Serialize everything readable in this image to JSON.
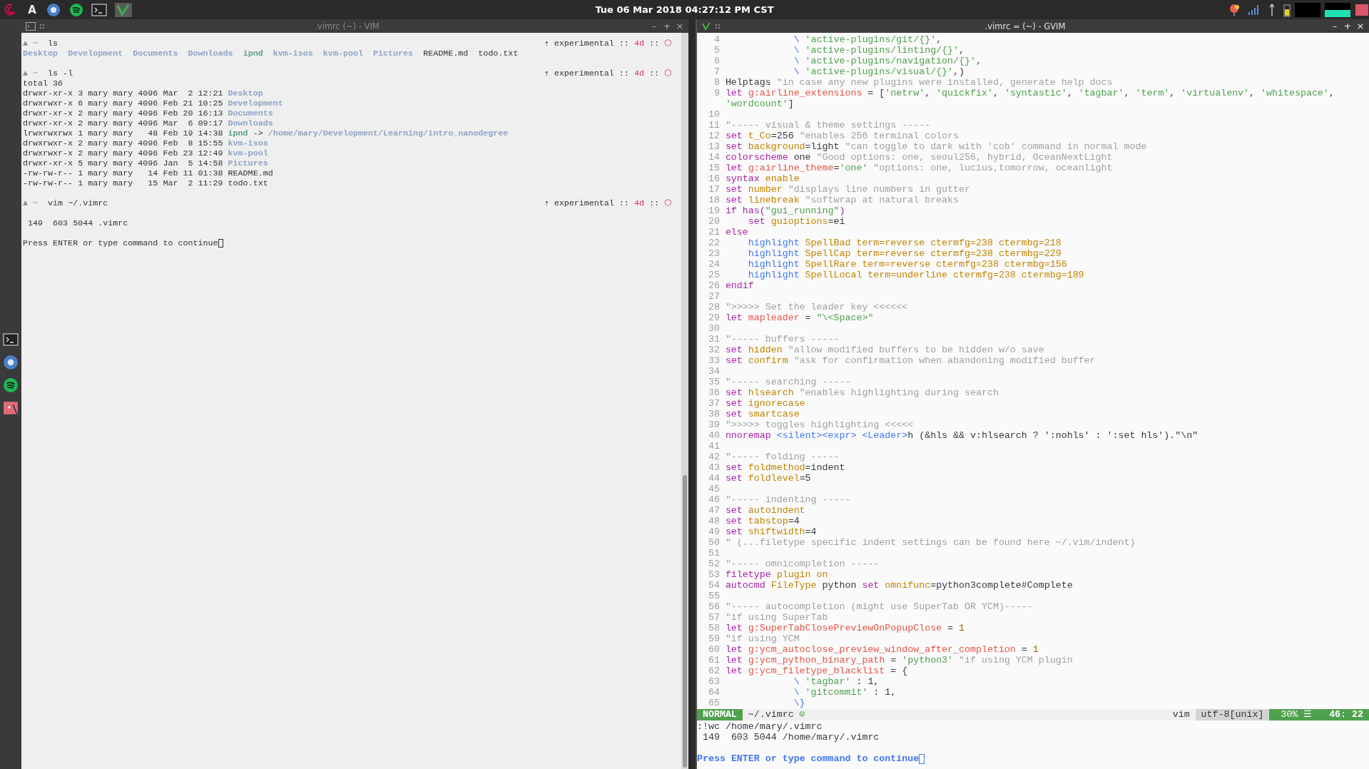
{
  "panel": {
    "launcher_letter": "A",
    "clock": "Tue 06 Mar 2018 04:27:12 PM CST"
  },
  "terminal_window": {
    "title": ".vimrc (~) - VIM",
    "active": false,
    "controls": [
      "–",
      "+",
      "×"
    ],
    "lines": [
      {
        "kind": "prompt",
        "segments": [
          {
            "kind": "prompt",
            "text": "▲ ~  "
          },
          {
            "kind": "plain",
            "text": "ls"
          }
        ],
        "status": [
          {
            "kind": "plain",
            "text": "⇡ experimental :: "
          },
          {
            "kind": "age",
            "text": "4d"
          },
          {
            "kind": "plain",
            "text": " :: "
          },
          {
            "kind": "mark",
            "text": "⬡"
          }
        ]
      },
      {
        "kind": "output",
        "segments": [
          {
            "kind": "dir",
            "text": "Desktop  "
          },
          {
            "kind": "dir",
            "text": "Development  "
          },
          {
            "kind": "dir",
            "text": "Documents  "
          },
          {
            "kind": "dir",
            "text": "Downloads  "
          },
          {
            "kind": "link",
            "text": "ipnd  "
          },
          {
            "kind": "dir",
            "text": "kvm-isos  "
          },
          {
            "kind": "dir",
            "text": "kvm-pool  "
          },
          {
            "kind": "dir",
            "text": "Pictures  "
          },
          {
            "kind": "plain",
            "text": "README.md  todo.txt"
          }
        ]
      },
      {
        "kind": "blank"
      },
      {
        "kind": "prompt",
        "segments": [
          {
            "kind": "prompt",
            "text": "▲ ~  "
          },
          {
            "kind": "plain",
            "text": "ls -l"
          }
        ],
        "status": [
          {
            "kind": "plain",
            "text": "⇡ experimental :: "
          },
          {
            "kind": "age",
            "text": "4d"
          },
          {
            "kind": "plain",
            "text": " :: "
          },
          {
            "kind": "mark",
            "text": "⬡"
          }
        ]
      },
      {
        "kind": "output",
        "segments": [
          {
            "kind": "plain",
            "text": "total 36"
          }
        ]
      },
      {
        "kind": "output",
        "segments": [
          {
            "kind": "plain",
            "text": "drwxr-xr-x 3 mary mary 4096 Mar  2 12:21 "
          },
          {
            "kind": "dir",
            "text": "Desktop"
          }
        ]
      },
      {
        "kind": "output",
        "segments": [
          {
            "kind": "plain",
            "text": "drwxrwxr-x 6 mary mary 4096 Feb 21 10:25 "
          },
          {
            "kind": "dir",
            "text": "Development"
          }
        ]
      },
      {
        "kind": "output",
        "segments": [
          {
            "kind": "plain",
            "text": "drwxr-xr-x 2 mary mary 4096 Feb 20 16:13 "
          },
          {
            "kind": "dir",
            "text": "Documents"
          }
        ]
      },
      {
        "kind": "output",
        "segments": [
          {
            "kind": "plain",
            "text": "drwxr-xr-x 2 mary mary 4096 Mar  6 09:17 "
          },
          {
            "kind": "dir",
            "text": "Downloads"
          }
        ]
      },
      {
        "kind": "output",
        "segments": [
          {
            "kind": "plain",
            "text": "lrwxrwxrwx 1 mary mary   48 Feb 19 14:38 "
          },
          {
            "kind": "link",
            "text": "ipnd"
          },
          {
            "kind": "plain",
            "text": " -> "
          },
          {
            "kind": "dir",
            "text": "/home/mary/Development/Learning/intro_nanodegree"
          }
        ]
      },
      {
        "kind": "output",
        "segments": [
          {
            "kind": "plain",
            "text": "drwxrwxr-x 2 mary mary 4096 Feb  8 15:55 "
          },
          {
            "kind": "dir",
            "text": "kvm-isos"
          }
        ]
      },
      {
        "kind": "output",
        "segments": [
          {
            "kind": "plain",
            "text": "drwxrwxr-x 2 mary mary 4096 Feb 23 12:49 "
          },
          {
            "kind": "dir",
            "text": "kvm-pool"
          }
        ]
      },
      {
        "kind": "output",
        "segments": [
          {
            "kind": "plain",
            "text": "drwxr-xr-x 5 mary mary 4096 Jan  5 14:58 "
          },
          {
            "kind": "dir",
            "text": "Pictures"
          }
        ]
      },
      {
        "kind": "output",
        "segments": [
          {
            "kind": "plain",
            "text": "-rw-rw-r-- 1 mary mary   14 Feb 11 01:38 README.md"
          }
        ]
      },
      {
        "kind": "output",
        "segments": [
          {
            "kind": "plain",
            "text": "-rw-rw-r-- 1 mary mary   15 Mar  2 11:29 todo.txt"
          }
        ]
      },
      {
        "kind": "blank"
      },
      {
        "kind": "prompt",
        "segments": [
          {
            "kind": "prompt",
            "text": "▲ ~  "
          },
          {
            "kind": "plain",
            "text": "vim ~/.vimrc"
          }
        ],
        "status": [
          {
            "kind": "plain",
            "text": "⇡ experimental :: "
          },
          {
            "kind": "age",
            "text": "4d"
          },
          {
            "kind": "plain",
            "text": " :: "
          },
          {
            "kind": "mark",
            "text": "⬡"
          }
        ]
      },
      {
        "kind": "blank"
      },
      {
        "kind": "output",
        "segments": [
          {
            "kind": "plain",
            "text": " 149  603 5044 .vimrc"
          }
        ]
      },
      {
        "kind": "blank"
      },
      {
        "kind": "cursor",
        "segments": [
          {
            "kind": "plain",
            "text": "Press ENTER or type command to continue"
          }
        ]
      }
    ]
  },
  "gvim_window": {
    "title": ".vimrc = (~) - GVIM",
    "active": true,
    "controls": [
      "–",
      "+",
      "×"
    ],
    "lines": [
      {
        "n": "4",
        "t": [
          {
            "kind": "spec",
            "text": "            \\ "
          },
          {
            "kind": "str",
            "text": "'active-plugins/git/{}'"
          },
          {
            "kind": "plain",
            "text": ","
          }
        ]
      },
      {
        "n": "5",
        "t": [
          {
            "kind": "spec",
            "text": "            \\ "
          },
          {
            "kind": "str",
            "text": "'active-plugins/linting/{}'"
          },
          {
            "kind": "plain",
            "text": ","
          }
        ]
      },
      {
        "n": "6",
        "t": [
          {
            "kind": "spec",
            "text": "            \\ "
          },
          {
            "kind": "str",
            "text": "'active-plugins/navigation/{}'"
          },
          {
            "kind": "plain",
            "text": ","
          }
        ]
      },
      {
        "n": "7",
        "t": [
          {
            "kind": "spec",
            "text": "            \\ "
          },
          {
            "kind": "str",
            "text": "'active-plugins/visual/{}'"
          },
          {
            "kind": "plain",
            "text": ",)"
          }
        ]
      },
      {
        "n": "8",
        "t": [
          {
            "kind": "plain",
            "text": "Helptags "
          },
          {
            "kind": "cmt",
            "text": "\"in case any new plugins were installed, generate help docs"
          }
        ]
      },
      {
        "n": "9",
        "t": [
          {
            "kind": "kw",
            "text": "let "
          },
          {
            "kind": "var",
            "text": "g:airline_extensions"
          },
          {
            "kind": "plain",
            "text": " = ["
          },
          {
            "kind": "str",
            "text": "'netrw'"
          },
          {
            "kind": "plain",
            "text": ", "
          },
          {
            "kind": "str",
            "text": "'quickfix'"
          },
          {
            "kind": "plain",
            "text": ", "
          },
          {
            "kind": "str",
            "text": "'syntastic'"
          },
          {
            "kind": "plain",
            "text": ", "
          },
          {
            "kind": "str",
            "text": "'tagbar'"
          },
          {
            "kind": "plain",
            "text": ", "
          },
          {
            "kind": "str",
            "text": "'term'"
          },
          {
            "kind": "plain",
            "text": ", "
          },
          {
            "kind": "str",
            "text": "'virtualenv'"
          },
          {
            "kind": "plain",
            "text": ", "
          },
          {
            "kind": "str",
            "text": "'whitespace'"
          },
          {
            "kind": "plain",
            "text": ","
          }
        ]
      },
      {
        "t": [
          {
            "kind": "str",
            "text": "'wordcount'"
          },
          {
            "kind": "plain",
            "text": "]"
          }
        ]
      },
      {
        "n": "10"
      },
      {
        "n": "11",
        "t": [
          {
            "kind": "cmt",
            "text": "\"----- visual & theme settings -----"
          }
        ]
      },
      {
        "n": "12",
        "t": [
          {
            "kind": "kw",
            "text": "set "
          },
          {
            "kind": "opt",
            "text": "t_Co"
          },
          {
            "kind": "plain",
            "text": "=256 "
          },
          {
            "kind": "cmt",
            "text": "\"enables 256 terminal colors"
          }
        ]
      },
      {
        "n": "13",
        "t": [
          {
            "kind": "kw",
            "text": "set "
          },
          {
            "kind": "opt",
            "text": "background"
          },
          {
            "kind": "plain",
            "text": "=light "
          },
          {
            "kind": "cmt",
            "text": "\"can toggle to dark with 'cob' command in normal mode"
          }
        ]
      },
      {
        "n": "14",
        "t": [
          {
            "kind": "kw",
            "text": "colorscheme "
          },
          {
            "kind": "plain",
            "text": "one "
          },
          {
            "kind": "cmt",
            "text": "\"Good options: one, seoul256, hybrid, OceanNextLight"
          }
        ]
      },
      {
        "n": "15",
        "t": [
          {
            "kind": "kw",
            "text": "let "
          },
          {
            "kind": "var",
            "text": "g:airline_theme"
          },
          {
            "kind": "plain",
            "text": "="
          },
          {
            "kind": "str",
            "text": "'one'"
          },
          {
            "kind": "cmt",
            "text": " \"options: one, lucius,tomorrow, oceanlight"
          }
        ]
      },
      {
        "n": "16",
        "t": [
          {
            "kind": "kw",
            "text": "syntax "
          },
          {
            "kind": "opt",
            "text": "enable"
          }
        ]
      },
      {
        "n": "17",
        "t": [
          {
            "kind": "kw",
            "text": "set "
          },
          {
            "kind": "opt",
            "text": "number "
          },
          {
            "kind": "cmt",
            "text": "\"displays line numbers in gutter"
          }
        ]
      },
      {
        "n": "18",
        "t": [
          {
            "kind": "kw",
            "text": "set "
          },
          {
            "kind": "opt",
            "text": "linebreak "
          },
          {
            "kind": "cmt",
            "text": "\"softwrap at natural breaks"
          }
        ]
      },
      {
        "n": "19",
        "t": [
          {
            "kind": "kw",
            "text": "if has("
          },
          {
            "kind": "str",
            "text": "\"gui_running\""
          },
          {
            "kind": "kw",
            "text": ")"
          }
        ]
      },
      {
        "n": "20",
        "t": [
          {
            "kind": "kw",
            "text": "    set "
          },
          {
            "kind": "opt",
            "text": "guioptions"
          },
          {
            "kind": "plain",
            "text": "=ei"
          }
        ]
      },
      {
        "n": "21",
        "t": [
          {
            "kind": "kw",
            "text": "else"
          }
        ]
      },
      {
        "n": "22",
        "t": [
          {
            "kind": "spec",
            "text": "    highlight "
          },
          {
            "kind": "opt",
            "text": "SpellBad term=reverse ctermfg=238 ctermbg=218"
          }
        ]
      },
      {
        "n": "23",
        "t": [
          {
            "kind": "spec",
            "text": "    highlight "
          },
          {
            "kind": "opt",
            "text": "SpellCap term=reverse ctermfg=238 ctermbg=229"
          }
        ]
      },
      {
        "n": "24",
        "t": [
          {
            "kind": "spec",
            "text": "    highlight "
          },
          {
            "kind": "opt",
            "text": "SpellRare term=reverse ctermfg=238 ctermbg=156"
          }
        ]
      },
      {
        "n": "25",
        "t": [
          {
            "kind": "spec",
            "text": "    highlight "
          },
          {
            "kind": "opt",
            "text": "SpellLocal term=underline ctermfg=238 ctermbg=189"
          }
        ]
      },
      {
        "n": "26",
        "t": [
          {
            "kind": "kw",
            "text": "endif"
          }
        ]
      },
      {
        "n": "27"
      },
      {
        "n": "28",
        "t": [
          {
            "kind": "cmt",
            "text": "\">>>>> Set the leader key <<<<<<"
          }
        ]
      },
      {
        "n": "29",
        "t": [
          {
            "kind": "kw",
            "text": "let "
          },
          {
            "kind": "var",
            "text": "mapleader"
          },
          {
            "kind": "plain",
            "text": " = "
          },
          {
            "kind": "str",
            "text": "\"\\<Space>\""
          }
        ]
      },
      {
        "n": "30"
      },
      {
        "n": "31",
        "t": [
          {
            "kind": "cmt",
            "text": "\"----- buffers -----"
          }
        ]
      },
      {
        "n": "32",
        "t": [
          {
            "kind": "kw",
            "text": "set "
          },
          {
            "kind": "opt",
            "text": "hidden "
          },
          {
            "kind": "cmt",
            "text": "\"allow modified buffers to be hidden w/o save"
          }
        ]
      },
      {
        "n": "33",
        "t": [
          {
            "kind": "kw",
            "text": "set "
          },
          {
            "kind": "opt",
            "text": "confirm "
          },
          {
            "kind": "cmt",
            "text": "\"ask for confirmation when abandoning modified buffer"
          }
        ]
      },
      {
        "n": "34"
      },
      {
        "n": "35",
        "t": [
          {
            "kind": "cmt",
            "text": "\"----- searching -----"
          }
        ]
      },
      {
        "n": "36",
        "t": [
          {
            "kind": "kw",
            "text": "set "
          },
          {
            "kind": "opt",
            "text": "hlsearch "
          },
          {
            "kind": "cmt",
            "text": "\"enables highlighting during search"
          }
        ]
      },
      {
        "n": "37",
        "t": [
          {
            "kind": "kw",
            "text": "set "
          },
          {
            "kind": "opt",
            "text": "ignorecase"
          }
        ]
      },
      {
        "n": "38",
        "t": [
          {
            "kind": "kw",
            "text": "set "
          },
          {
            "kind": "opt",
            "text": "smartcase"
          }
        ]
      },
      {
        "n": "39",
        "t": [
          {
            "kind": "cmt",
            "text": "\">>>>> toggles highlighting <<<<<"
          }
        ]
      },
      {
        "n": "40",
        "t": [
          {
            "kind": "kw",
            "text": "nnoremap "
          },
          {
            "kind": "spec",
            "text": "<silent><expr> <Leader>"
          },
          {
            "kind": "plain",
            "text": "h (&hls && v:hlsearch ? ':nohls' : ':set hls').\"\\n\""
          }
        ]
      },
      {
        "n": "41"
      },
      {
        "n": "42",
        "t": [
          {
            "kind": "cmt",
            "text": "\"----- folding -----"
          }
        ]
      },
      {
        "n": "43",
        "t": [
          {
            "kind": "kw",
            "text": "set "
          },
          {
            "kind": "opt",
            "text": "foldmethod"
          },
          {
            "kind": "plain",
            "text": "=indent"
          }
        ]
      },
      {
        "n": "44",
        "t": [
          {
            "kind": "kw",
            "text": "set "
          },
          {
            "kind": "opt",
            "text": "foldlevel"
          },
          {
            "kind": "plain",
            "text": "=5"
          }
        ]
      },
      {
        "n": "45"
      },
      {
        "n": "46",
        "t": [
          {
            "kind": "cmt",
            "text": "\"----- indenting -----"
          }
        ]
      },
      {
        "n": "47",
        "t": [
          {
            "kind": "kw",
            "text": "set "
          },
          {
            "kind": "opt",
            "text": "autoindent"
          }
        ]
      },
      {
        "n": "48",
        "t": [
          {
            "kind": "kw",
            "text": "set "
          },
          {
            "kind": "opt",
            "text": "tabstop"
          },
          {
            "kind": "plain",
            "text": "=4"
          }
        ]
      },
      {
        "n": "49",
        "t": [
          {
            "kind": "kw",
            "text": "set "
          },
          {
            "kind": "opt",
            "text": "shiftwidth"
          },
          {
            "kind": "plain",
            "text": "=4"
          }
        ]
      },
      {
        "n": "50",
        "t": [
          {
            "kind": "cmt",
            "text": "\" (...filetype specific indent settings can be found here ~/.vim/indent)"
          }
        ]
      },
      {
        "n": "51"
      },
      {
        "n": "52",
        "t": [
          {
            "kind": "cmt",
            "text": "\"----- omnicompletion -----"
          }
        ]
      },
      {
        "n": "53",
        "t": [
          {
            "kind": "kw",
            "text": "filetype "
          },
          {
            "kind": "opt",
            "text": "plugin on"
          }
        ]
      },
      {
        "n": "54",
        "t": [
          {
            "kind": "kw",
            "text": "autocmd "
          },
          {
            "kind": "opt",
            "text": "FileType "
          },
          {
            "kind": "plain",
            "text": "python "
          },
          {
            "kind": "kw",
            "text": "set "
          },
          {
            "kind": "opt",
            "text": "omnifunc"
          },
          {
            "kind": "plain",
            "text": "=python3complete#Complete"
          }
        ]
      },
      {
        "n": "55"
      },
      {
        "n": "56",
        "t": [
          {
            "kind": "cmt",
            "text": "\"----- autocompletion (might use SuperTab OR YCM)-----"
          }
        ]
      },
      {
        "n": "57",
        "t": [
          {
            "kind": "cmt",
            "text": "\"if using SuperTab"
          }
        ]
      },
      {
        "n": "58",
        "t": [
          {
            "kind": "kw",
            "text": "let "
          },
          {
            "kind": "var",
            "text": "g:SuperTabClosePreviewOnPopupClose"
          },
          {
            "kind": "plain",
            "text": " = "
          },
          {
            "kind": "num",
            "text": "1"
          }
        ]
      },
      {
        "n": "59",
        "t": [
          {
            "kind": "cmt",
            "text": "\"if using YCM"
          }
        ]
      },
      {
        "n": "60",
        "t": [
          {
            "kind": "kw",
            "text": "let "
          },
          {
            "kind": "var",
            "text": "g:ycm_autoclose_preview_window_after_completion"
          },
          {
            "kind": "plain",
            "text": " = "
          },
          {
            "kind": "num",
            "text": "1"
          }
        ]
      },
      {
        "n": "61",
        "t": [
          {
            "kind": "kw",
            "text": "let "
          },
          {
            "kind": "var",
            "text": "g:ycm_python_binary_path"
          },
          {
            "kind": "plain",
            "text": " = "
          },
          {
            "kind": "str",
            "text": "'python3'"
          },
          {
            "kind": "cmt",
            "text": " \"if using YCM plugin"
          }
        ]
      },
      {
        "n": "62",
        "t": [
          {
            "kind": "kw",
            "text": "let "
          },
          {
            "kind": "var",
            "text": "g:ycm_filetype_blacklist"
          },
          {
            "kind": "plain",
            "text": " = {"
          }
        ]
      },
      {
        "n": "63",
        "t": [
          {
            "kind": "spec",
            "text": "            \\ "
          },
          {
            "kind": "str",
            "text": "'tagbar'"
          },
          {
            "kind": "plain",
            "text": " : 1,"
          }
        ]
      },
      {
        "n": "64",
        "t": [
          {
            "kind": "spec",
            "text": "            \\ "
          },
          {
            "kind": "str",
            "text": "'gitcommit'"
          },
          {
            "kind": "plain",
            "text": " : 1,"
          }
        ]
      },
      {
        "n": "65",
        "t": [
          {
            "kind": "spec",
            "text": "            \\}"
          }
        ]
      }
    ],
    "statusline": {
      "mode": "NORMAL",
      "file": "~/.vimrc",
      "file_flag": "⊙",
      "filetype": "vim",
      "encoding": "utf-8[unix]",
      "percent": "30% ☰",
      "position": "46: 22"
    },
    "command_output": [
      ":!wc /home/mary/.vimrc",
      " 149  603 5044 /home/mary/.vimrc"
    ],
    "command_prompt": "Press ENTER or type command to continue"
  }
}
